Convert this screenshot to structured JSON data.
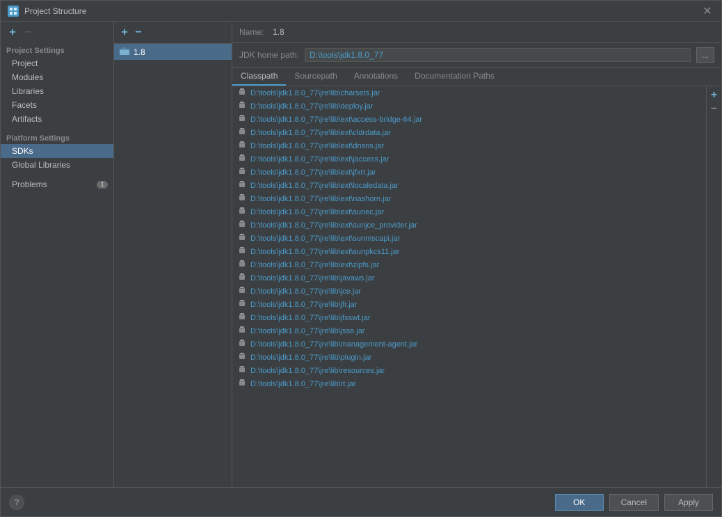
{
  "dialog": {
    "title": "Project Structure",
    "close_label": "✕"
  },
  "sidebar": {
    "toolbar": {
      "add_label": "+",
      "remove_label": "−"
    },
    "project_settings_label": "Project Settings",
    "project_items": [
      {
        "label": "Project"
      },
      {
        "label": "Modules"
      },
      {
        "label": "Libraries"
      },
      {
        "label": "Facets"
      },
      {
        "label": "Artifacts"
      }
    ],
    "platform_settings_label": "Platform Settings",
    "platform_items": [
      {
        "label": "SDKs",
        "active": true
      },
      {
        "label": "Global Libraries"
      }
    ],
    "problems_label": "Problems",
    "problems_badge": "1"
  },
  "sdk_list": {
    "add_label": "+",
    "remove_label": "−",
    "items": [
      {
        "label": "1.8",
        "icon": "📁"
      }
    ]
  },
  "detail": {
    "name_label": "Name:",
    "name_value": "1.8",
    "jdk_home_label": "JDK home path:",
    "jdk_home_value": "D:\\tools\\jdk1.8.0_77",
    "jdk_home_btn": "...",
    "tabs": [
      {
        "label": "Classpath",
        "active": true
      },
      {
        "label": "Sourcepath"
      },
      {
        "label": "Annotations"
      },
      {
        "label": "Documentation Paths"
      }
    ],
    "add_label": "+",
    "remove_label": "−",
    "classpath_items": [
      "D:\\tools\\jdk1.8.0_77\\jre\\lib\\charsets.jar",
      "D:\\tools\\jdk1.8.0_77\\jre\\lib\\deploy.jar",
      "D:\\tools\\jdk1.8.0_77\\jre\\lib\\ext\\access-bridge-64.jar",
      "D:\\tools\\jdk1.8.0_77\\jre\\lib\\ext\\cldrdata.jar",
      "D:\\tools\\jdk1.8.0_77\\jre\\lib\\ext\\dnsns.jar",
      "D:\\tools\\jdk1.8.0_77\\jre\\lib\\ext\\jaccess.jar",
      "D:\\tools\\jdk1.8.0_77\\jre\\lib\\ext\\jfxrt.jar",
      "D:\\tools\\jdk1.8.0_77\\jre\\lib\\ext\\localedata.jar",
      "D:\\tools\\jdk1.8.0_77\\jre\\lib\\ext\\nashorn.jar",
      "D:\\tools\\jdk1.8.0_77\\jre\\lib\\ext\\sunec.jar",
      "D:\\tools\\jdk1.8.0_77\\jre\\lib\\ext\\sunjce_provider.jar",
      "D:\\tools\\jdk1.8.0_77\\jre\\lib\\ext\\sunmscapi.jar",
      "D:\\tools\\jdk1.8.0_77\\jre\\lib\\ext\\sunpkcs11.jar",
      "D:\\tools\\jdk1.8.0_77\\jre\\lib\\ext\\zipfs.jar",
      "D:\\tools\\jdk1.8.0_77\\jre\\lib\\javaws.jar",
      "D:\\tools\\jdk1.8.0_77\\jre\\lib\\jce.jar",
      "D:\\tools\\jdk1.8.0_77\\jre\\lib\\jfr.jar",
      "D:\\tools\\jdk1.8.0_77\\jre\\lib\\jfxswt.jar",
      "D:\\tools\\jdk1.8.0_77\\jre\\lib\\jsse.jar",
      "D:\\tools\\jdk1.8.0_77\\jre\\lib\\management-agent.jar",
      "D:\\tools\\jdk1.8.0_77\\jre\\lib\\plugin.jar",
      "D:\\tools\\jdk1.8.0_77\\jre\\lib\\resources.jar",
      "D:\\tools\\jdk1.8.0_77\\jre\\lib\\rt.jar"
    ]
  },
  "bottom": {
    "help_label": "?",
    "ok_label": "OK",
    "cancel_label": "Cancel",
    "apply_label": "Apply"
  }
}
